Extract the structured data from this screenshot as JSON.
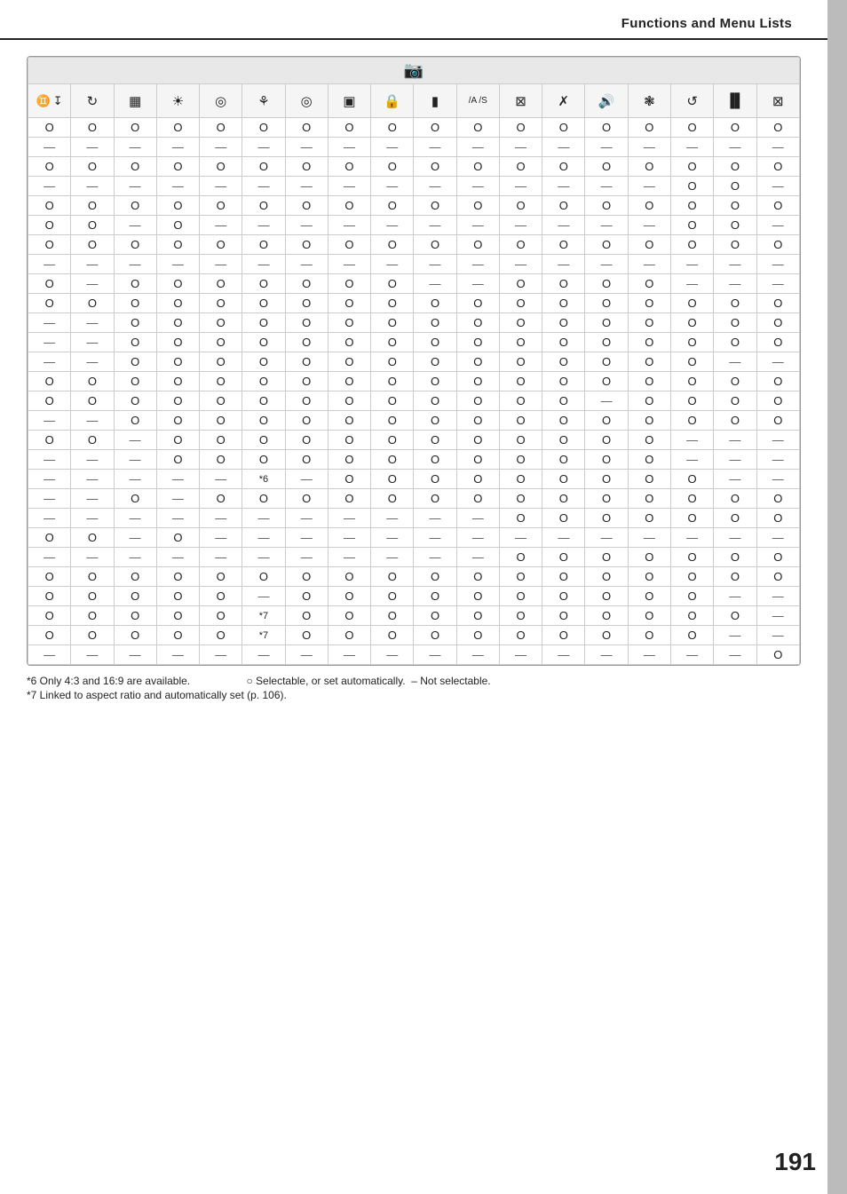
{
  "header": {
    "title": "Functions and Menu Lists"
  },
  "camera_icon": "📷",
  "column_icons": [
    "뚤",
    "🌀",
    "📋",
    "🔆",
    "🎯",
    "🎨",
    "⊙",
    "◲",
    "🔒",
    "📷",
    "/A /S",
    "🖼",
    "✂",
    "🔈",
    "🌐",
    "↺",
    "🖥",
    "🎮"
  ],
  "col_symbols": [
    "⬛",
    "☆",
    "▦",
    "⊕",
    "◎",
    "✿",
    "◎",
    "▣",
    "🔐",
    "■",
    "/A/S",
    "⊞",
    "✗",
    "🔊",
    "❋",
    "↺",
    "▬",
    "⊞"
  ],
  "rows": [
    [
      "O",
      "O",
      "O",
      "O",
      "O",
      "O",
      "O",
      "O",
      "O",
      "O",
      "O",
      "O",
      "O",
      "O",
      "O",
      "O",
      "O",
      "O"
    ],
    [
      "—",
      "—",
      "—",
      "—",
      "—",
      "—",
      "—",
      "—",
      "—",
      "—",
      "—",
      "—",
      "—",
      "—",
      "—",
      "—",
      "—",
      "—"
    ],
    [
      "O",
      "O",
      "O",
      "O",
      "O",
      "O",
      "O",
      "O",
      "O",
      "O",
      "O",
      "O",
      "O",
      "O",
      "O",
      "O",
      "O",
      "O"
    ],
    [
      "—",
      "—",
      "—",
      "—",
      "—",
      "—",
      "—",
      "—",
      "—",
      "—",
      "—",
      "—",
      "—",
      "—",
      "—",
      "O",
      "O",
      "—"
    ],
    [
      "O",
      "O",
      "O",
      "O",
      "O",
      "O",
      "O",
      "O",
      "O",
      "O",
      "O",
      "O",
      "O",
      "O",
      "O",
      "O",
      "O",
      "O"
    ],
    [
      "O",
      "O",
      "—",
      "O",
      "—",
      "—",
      "—",
      "—",
      "—",
      "—",
      "—",
      "—",
      "—",
      "—",
      "—",
      "O",
      "O",
      "—"
    ],
    [
      "O",
      "O",
      "O",
      "O",
      "O",
      "O",
      "O",
      "O",
      "O",
      "O",
      "O",
      "O",
      "O",
      "O",
      "O",
      "O",
      "O",
      "O"
    ],
    [
      "—",
      "—",
      "—",
      "—",
      "—",
      "—",
      "—",
      "—",
      "—",
      "—",
      "—",
      "—",
      "—",
      "—",
      "—",
      "—",
      "—",
      "—"
    ],
    [
      "O",
      "—",
      "O",
      "O",
      "O",
      "O",
      "O",
      "O",
      "O",
      "—",
      "—",
      "O",
      "O",
      "O",
      "O",
      "—",
      "—",
      "—"
    ],
    [
      "O",
      "O",
      "O",
      "O",
      "O",
      "O",
      "O",
      "O",
      "O",
      "O",
      "O",
      "O",
      "O",
      "O",
      "O",
      "O",
      "O",
      "O"
    ],
    [
      "—",
      "—",
      "O",
      "O",
      "O",
      "O",
      "O",
      "O",
      "O",
      "O",
      "O",
      "O",
      "O",
      "O",
      "O",
      "O",
      "O",
      "O"
    ],
    [
      "—",
      "—",
      "O",
      "O",
      "O",
      "O",
      "O",
      "O",
      "O",
      "O",
      "O",
      "O",
      "O",
      "O",
      "O",
      "O",
      "O",
      "O"
    ],
    [
      "—",
      "—",
      "O",
      "O",
      "O",
      "O",
      "O",
      "O",
      "O",
      "O",
      "O",
      "O",
      "O",
      "O",
      "O",
      "O",
      "—",
      "—"
    ],
    [
      "O",
      "O",
      "O",
      "O",
      "O",
      "O",
      "O",
      "O",
      "O",
      "O",
      "O",
      "O",
      "O",
      "O",
      "O",
      "O",
      "O",
      "O"
    ],
    [
      "O",
      "O",
      "O",
      "O",
      "O",
      "O",
      "O",
      "O",
      "O",
      "O",
      "O",
      "O",
      "O",
      "—",
      "O",
      "O",
      "O",
      "O"
    ],
    [
      "—",
      "—",
      "O",
      "O",
      "O",
      "O",
      "O",
      "O",
      "O",
      "O",
      "O",
      "O",
      "O",
      "O",
      "O",
      "O",
      "O",
      "O"
    ],
    [
      "O",
      "O",
      "—",
      "O",
      "O",
      "O",
      "O",
      "O",
      "O",
      "O",
      "O",
      "O",
      "O",
      "O",
      "O",
      "—",
      "—",
      "—"
    ],
    [
      "—",
      "—",
      "—",
      "O",
      "O",
      "O",
      "O",
      "O",
      "O",
      "O",
      "O",
      "O",
      "O",
      "O",
      "O",
      "—",
      "—",
      "—"
    ],
    [
      "—",
      "—",
      "—",
      "—",
      "—",
      "*6",
      "—",
      "O",
      "O",
      "O",
      "O",
      "O",
      "O",
      "O",
      "O",
      "O",
      "—",
      "—"
    ],
    [
      "—",
      "—",
      "O",
      "—",
      "O",
      "O",
      "O",
      "O",
      "O",
      "O",
      "O",
      "O",
      "O",
      "O",
      "O",
      "O",
      "O",
      "O"
    ],
    [
      "—",
      "—",
      "—",
      "—",
      "—",
      "—",
      "—",
      "—",
      "—",
      "—",
      "—",
      "O",
      "O",
      "O",
      "O",
      "O",
      "O",
      "O"
    ],
    [
      "O",
      "O",
      "—",
      "O",
      "—",
      "—",
      "—",
      "—",
      "—",
      "—",
      "—",
      "—",
      "—",
      "—",
      "—",
      "—",
      "—",
      "—"
    ],
    [
      "—",
      "—",
      "—",
      "—",
      "—",
      "—",
      "—",
      "—",
      "—",
      "—",
      "—",
      "O",
      "O",
      "O",
      "O",
      "O",
      "O",
      "O"
    ],
    [
      "O",
      "O",
      "O",
      "O",
      "O",
      "O",
      "O",
      "O",
      "O",
      "O",
      "O",
      "O",
      "O",
      "O",
      "O",
      "O",
      "O",
      "O"
    ],
    [
      "O",
      "O",
      "O",
      "O",
      "O",
      "—",
      "O",
      "O",
      "O",
      "O",
      "O",
      "O",
      "O",
      "O",
      "O",
      "O",
      "—",
      "—"
    ],
    [
      "O",
      "O",
      "O",
      "O",
      "O",
      "*7",
      "O",
      "O",
      "O",
      "O",
      "O",
      "O",
      "O",
      "O",
      "O",
      "O",
      "O",
      "—"
    ],
    [
      "O",
      "O",
      "O",
      "O",
      "O",
      "*7",
      "O",
      "O",
      "O",
      "O",
      "O",
      "O",
      "O",
      "O",
      "O",
      "O",
      "—",
      "—"
    ],
    [
      "—",
      "—",
      "—",
      "—",
      "—",
      "—",
      "—",
      "—",
      "—",
      "—",
      "—",
      "—",
      "—",
      "—",
      "—",
      "—",
      "—",
      "O"
    ]
  ],
  "footnotes": {
    "note6": "*6 Only 4:3 and 16:9 are available.",
    "note7": "*7 Linked to aspect ratio and automatically set (p. 106).",
    "legend_o": "○ Selectable, or set automatically.",
    "legend_dash": "– Not selectable."
  },
  "page_number": "191"
}
